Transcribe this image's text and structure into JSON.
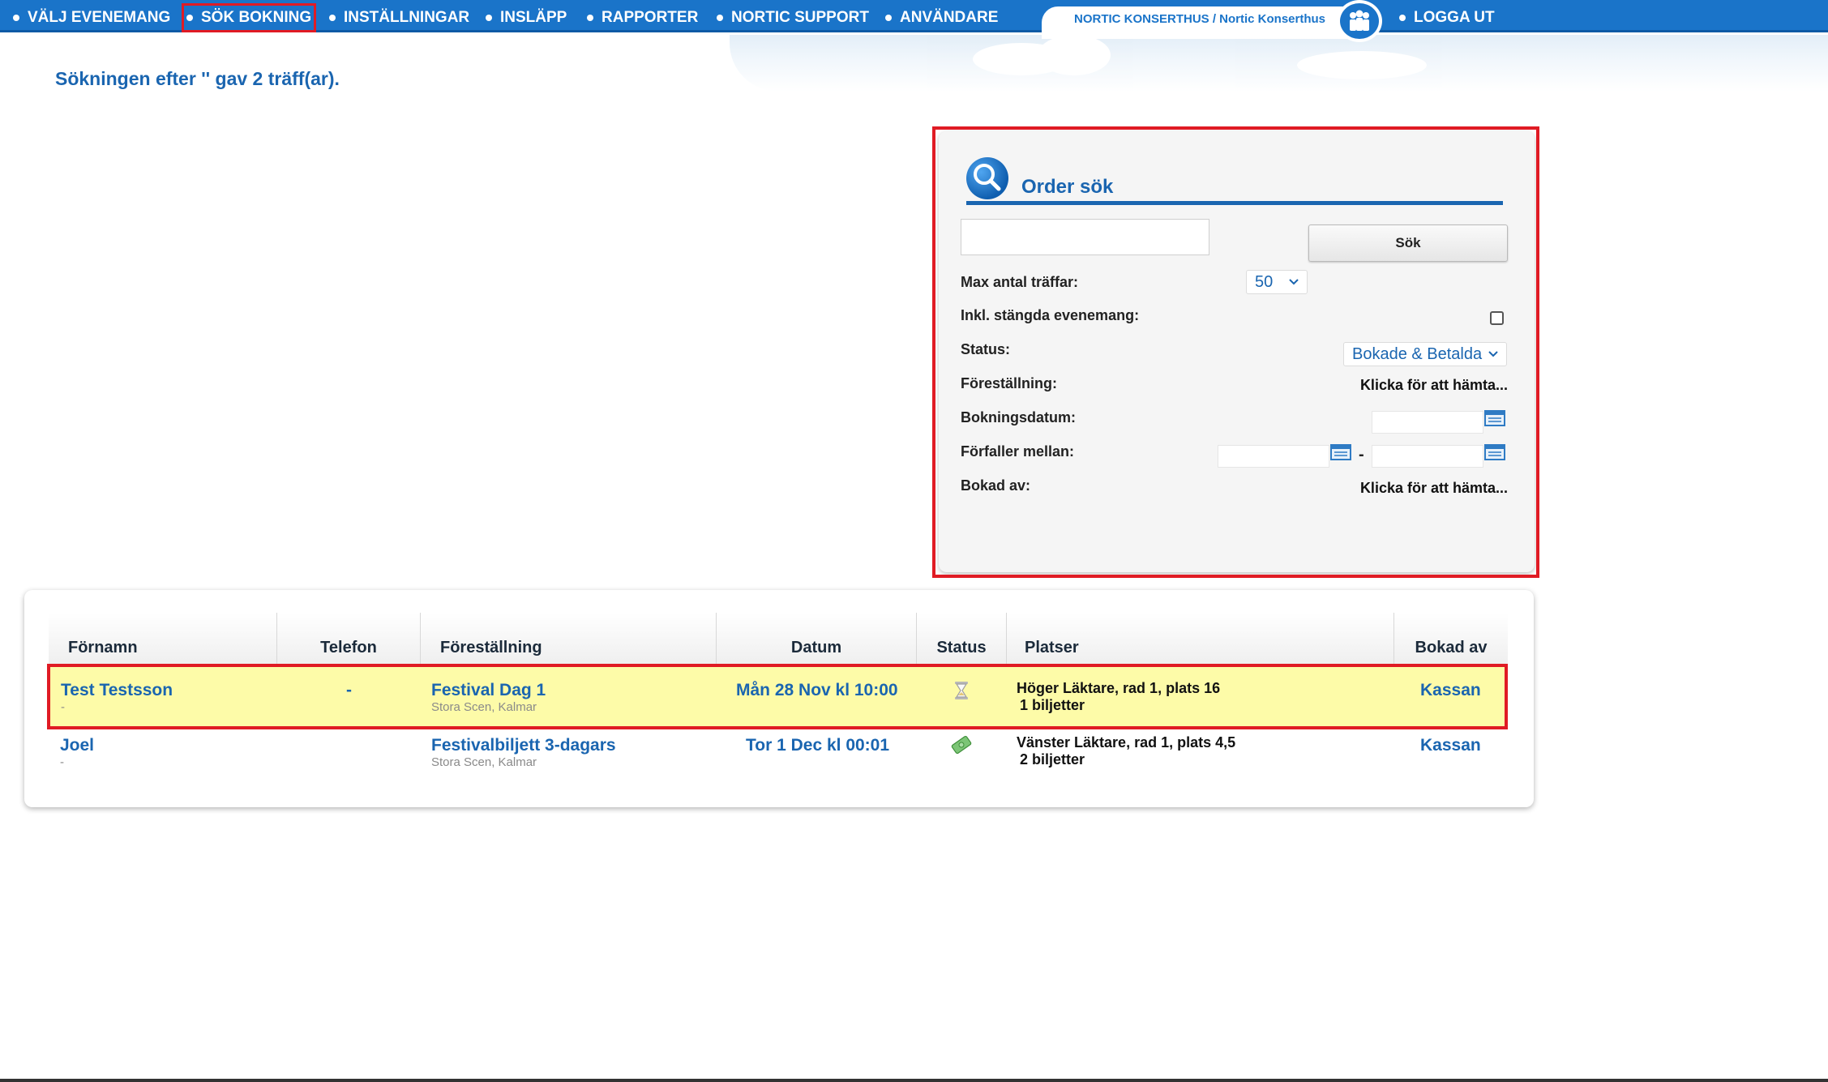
{
  "nav": {
    "items": [
      {
        "label": "VÄLJ EVENEMANG"
      },
      {
        "label": "SÖK BOKNING"
      },
      {
        "label": "INSTÄLLNINGAR"
      },
      {
        "label": "INSLÄPP"
      },
      {
        "label": "RAPPORTER"
      },
      {
        "label": "NORTIC SUPPORT"
      },
      {
        "label": "ANVÄNDARE"
      }
    ],
    "active_label": "SÖK BOKNING",
    "org": "NORTIC KONSERTHUS / Nortic Konserthus",
    "user_icon": "users-icon",
    "logout_label": "LOGGA UT"
  },
  "heading": "Sökningen efter '' gav 2 träff(ar).",
  "search_panel": {
    "title": "Order sök",
    "title_icon": "magnifier-icon",
    "query_value": "",
    "search_button": "Sök",
    "max_hits_label": "Max antal träffar:",
    "max_hits_value": "50",
    "include_closed_label": "Inkl. stängda evenemang:",
    "include_closed_checked": false,
    "status_label": "Status:",
    "status_value": "Bokade & Betalda",
    "performance_label": "Föreställning:",
    "performance_link": "Klicka för att hämta...",
    "booking_date_label": "Bokningsdatum:",
    "expires_label": "Förfaller mellan:",
    "expires_separator": "-",
    "booked_by_label": "Bokad av:",
    "booked_by_link": "Klicka för att hämta..."
  },
  "table": {
    "headers": [
      "Förnamn",
      "Telefon",
      "Föreställning",
      "Datum",
      "Status",
      "Platser",
      "Bokad av"
    ],
    "rows": [
      {
        "first_name": "Test Testsson",
        "sub": "-",
        "phone": "-",
        "performance": "Festival Dag 1",
        "venue": "Stora Scen, Kalmar",
        "date": "Mån 28 Nov kl 10:00",
        "status_icon": "hourglass-icon",
        "seats": "Höger Läktare, rad 1, plats 16",
        "tickets": "1 biljetter",
        "booked_by": "Kassan"
      },
      {
        "first_name": "Joel",
        "sub": "-",
        "phone": "",
        "performance": "Festivalbiljett 3-dagars",
        "venue": "Stora Scen, Kalmar",
        "date": "Tor 1 Dec kl 00:01",
        "status_icon": "money-icon",
        "seats": "Vänster Läktare, rad 1, plats 4,5",
        "tickets": "2 biljetter",
        "booked_by": "Kassan"
      }
    ]
  },
  "colors": {
    "nav_blue": "#1a74c9",
    "link_blue": "#1a65b0",
    "highlight_row": "#fdfba8",
    "annotation_red": "#e01b24"
  }
}
